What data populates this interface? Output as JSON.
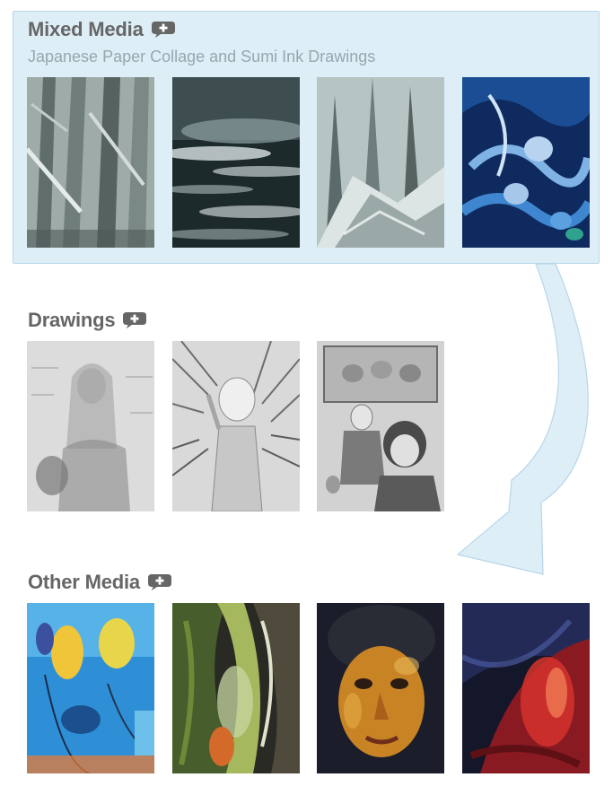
{
  "sections": {
    "mixed_media": {
      "title": "Mixed Media",
      "subtitle": "Japanese Paper Collage and Sumi Ink Drawings",
      "add_icon": "plus-speech-bubble-icon",
      "thumbnails": [
        {
          "name": "forest-trunks-collage"
        },
        {
          "name": "cloudy-seascape-collage"
        },
        {
          "name": "rocky-forest-collage"
        },
        {
          "name": "blue-swirling-figures-painting"
        }
      ]
    },
    "drawings": {
      "title": "Drawings",
      "add_icon": "plus-speech-bubble-icon",
      "thumbnails": [
        {
          "name": "woman-with-monkey-drawing"
        },
        {
          "name": "child-with-palms-drawing"
        },
        {
          "name": "two-women-portrait-drawing"
        }
      ]
    },
    "other_media": {
      "title": "Other Media",
      "add_icon": "plus-speech-bubble-icon",
      "thumbnails": [
        {
          "name": "blue-yellow-abstract"
        },
        {
          "name": "green-swirl-abstract"
        },
        {
          "name": "orange-face-portrait"
        },
        {
          "name": "red-blue-abstract"
        }
      ]
    }
  },
  "colors": {
    "panel_background": "#ddeef7",
    "panel_border": "#b8d6e8",
    "title_text": "#666666",
    "subtitle_text": "#98a7ae",
    "arrow_fill": "#ddeef7",
    "arrow_stroke": "#b8d6e8"
  }
}
